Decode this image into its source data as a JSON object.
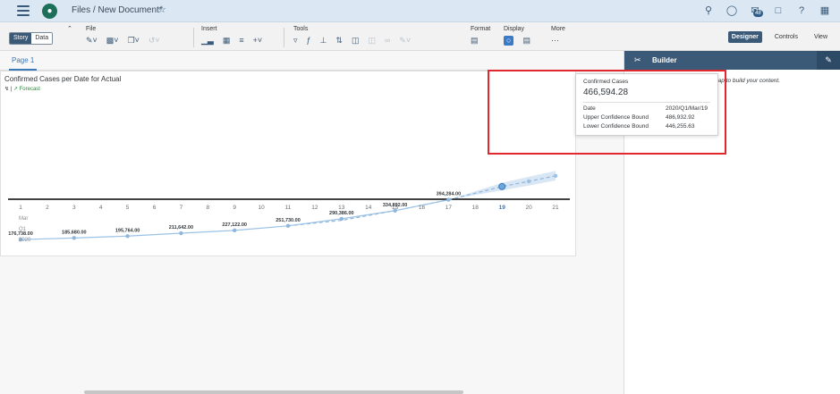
{
  "shell": {
    "breadcrumb_files": "Files",
    "breadcrumb_sep": "/",
    "breadcrumb_doc": "New Document*",
    "notification_count": "48"
  },
  "toolbar": {
    "story": "Story",
    "data": "Data",
    "file": "File",
    "insert": "Insert",
    "tools": "Tools",
    "format": "Format",
    "display": "Display",
    "more": "More",
    "designer": "Designer",
    "controls": "Controls",
    "view": "View"
  },
  "page_tab": "Page 1",
  "chart_card": {
    "title": "Confirmed Cases per Date for Actual",
    "legend_forecast": "Forecast"
  },
  "builder": {
    "title": "Builder",
    "hint": "Please select a chart, table, or map to build your content."
  },
  "tooltip": {
    "label": "Confirmed Cases",
    "value": "466,594.28",
    "date_label": "Date",
    "date_value": "2020/Q1/Mar/19",
    "upper_label": "Upper Confidence Bound",
    "upper_value": "486,932.92",
    "lower_label": "Lower Confidence Bound",
    "lower_value": "446,255.63"
  },
  "chart_data": {
    "type": "line",
    "title": "Confirmed Cases per Date for Actual",
    "x": [
      1,
      2,
      3,
      4,
      5,
      6,
      7,
      8,
      9,
      10,
      11,
      12,
      13,
      14,
      15,
      16,
      17,
      18,
      19,
      20,
      21
    ],
    "x_tick_labels": [
      "1",
      "2",
      "3",
      "4",
      "5",
      "6",
      "7",
      "8",
      "9",
      "10",
      "11",
      "12",
      "13",
      "14",
      "15",
      "16",
      "17",
      "18",
      "19",
      "20",
      "21"
    ],
    "x_sub_labels": [
      "Mar",
      "Q1",
      "2020"
    ],
    "highlighted_x": 19,
    "series": [
      {
        "name": "Actual",
        "x": [
          1,
          3,
          5,
          7,
          9,
          11,
          13,
          15,
          17
        ],
        "values": [
          176738,
          185680,
          195764,
          211642,
          227122,
          251730,
          290386,
          334892,
          394284
        ],
        "labels": [
          "176,738.00",
          "185,680.00",
          "195,764.00",
          "211,642.00",
          "227,122.00",
          "251,730.00",
          "290,386.00",
          "334,892.00",
          "394,284.00"
        ]
      },
      {
        "name": "Forecast",
        "x": [
          11,
          13,
          15,
          17,
          19,
          20,
          21
        ],
        "values": [
          251730,
          282000,
          334892,
          394284,
          466594.28,
          495000,
          525000
        ]
      }
    ],
    "confidence_band": {
      "x": [
        17,
        19,
        20,
        21
      ],
      "upper": [
        394284,
        486932.92,
        520000,
        552000
      ],
      "lower": [
        394284,
        446255.63,
        472000,
        500000
      ]
    },
    "ylim": [
      80000,
      900000
    ],
    "grid": false,
    "legend": "top-left"
  }
}
